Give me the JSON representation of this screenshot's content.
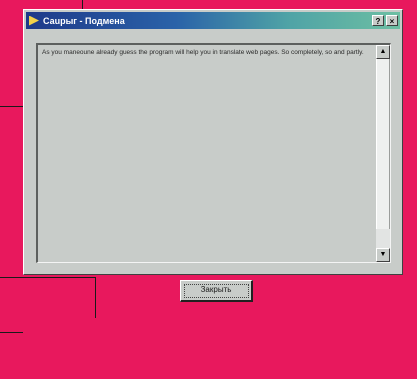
{
  "dialog": {
    "title": "Саuрыг - Подмена",
    "buttons": {
      "help": "?",
      "close": "×"
    },
    "message": "As you maneoune already guess the program will help you in translate web pages. So completely, so and partly.",
    "ok_label": "Закрыть"
  },
  "icons": {
    "title": "app-icon",
    "scroll_up": "scroll-up-arrow-icon",
    "scroll_down": "scroll-down-arrow-icon"
  },
  "colors": {
    "background": "#e8185d",
    "window": "#c8ccc9",
    "title_gradient_start": "#1e3a8a",
    "title_gradient_end": "#6dbfa3"
  }
}
